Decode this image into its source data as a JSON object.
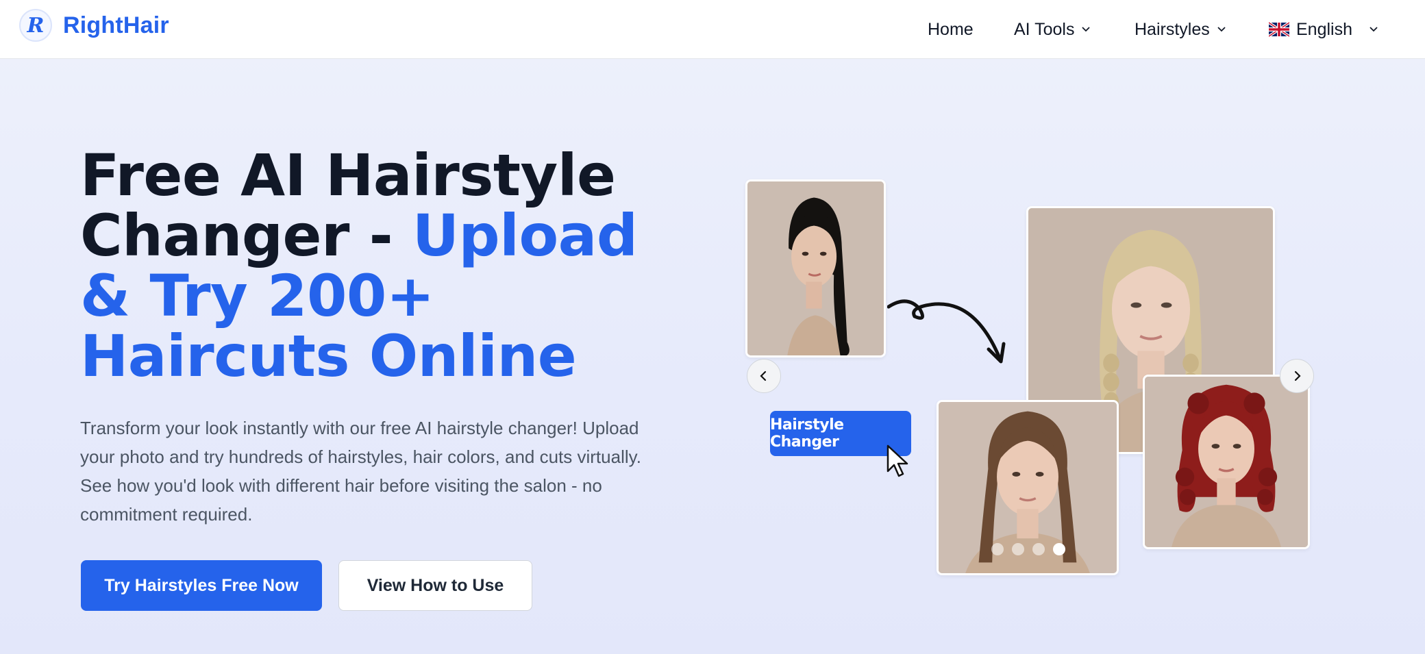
{
  "brand": {
    "name": "RightHair",
    "logo_letter": "R",
    "color": "#2563eb"
  },
  "nav": {
    "home": "Home",
    "ai_tools": "AI Tools",
    "hairstyles": "Hairstyles",
    "language": "English",
    "language_flag_icon": "uk-flag-icon"
  },
  "hero": {
    "title_dark": "Free AI Hairstyle Changer - ",
    "title_accent": "Upload & Try 200+ Haircuts Online",
    "description": "Transform your look instantly with our free AI hairstyle changer! Upload your photo and try hundreds of hairstyles, hair colors, and cuts virtually. See how you'd look with different hair before visiting the salon - no commitment required.",
    "primary_button": "Try Hairstyles Free Now",
    "secondary_button": "View How to Use"
  },
  "carousel": {
    "tag_label": "Hairstyle Changer",
    "slides_count": 4,
    "active_slide": 4,
    "photos": [
      "original-ponytail-photo",
      "blonde-braids-photo",
      "brown-long-hair-photo",
      "red-curly-hair-photo"
    ]
  },
  "colors": {
    "accent": "#2563eb",
    "text_dark": "#111827",
    "text_muted": "#4b5563"
  }
}
